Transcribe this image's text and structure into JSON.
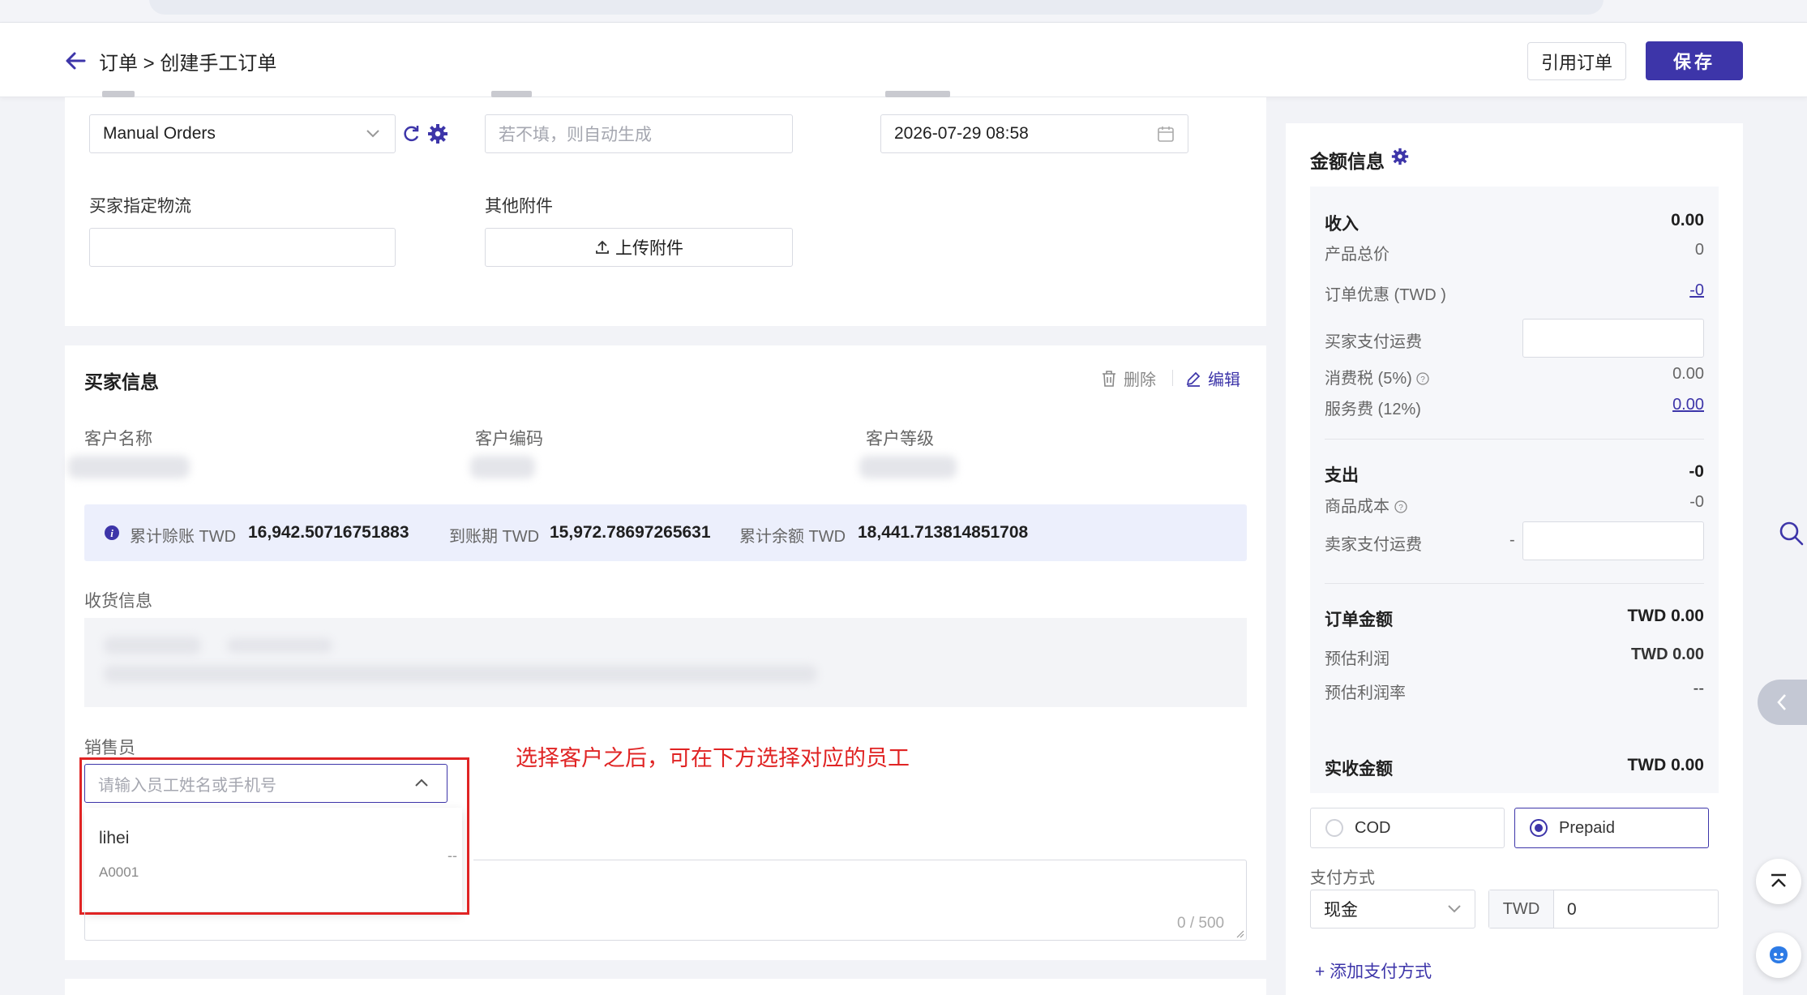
{
  "header": {
    "breadcrumb": "订单 > 创建手工订单",
    "reference_order_label": "引用订单",
    "save_label": "保存"
  },
  "order_info": {
    "store_select_value": "Manual Orders",
    "order_no_placeholder": "若不填，则自动生成",
    "order_time_value": "2026-07-29 08:58",
    "buyer_logistics_label": "买家指定物流",
    "attachments_label": "其他附件",
    "upload_label": "上传附件"
  },
  "buyer_info": {
    "title": "买家信息",
    "delete_label": "删除",
    "edit_label": "编辑",
    "customer_name_label": "客户名称",
    "customer_code_label": "客户编码",
    "customer_level_label": "客户等级",
    "stats": [
      {
        "label": "累计赊账 TWD",
        "value": "16,942.50716751883"
      },
      {
        "label": "到账期 TWD",
        "value": "15,972.78697265631"
      },
      {
        "label": "累计余额 TWD",
        "value": "18,441.713814851708"
      }
    ],
    "shipping_label": "收货信息",
    "sales_label": "销售员",
    "sales_placeholder": "请输入员工姓名或手机号",
    "dropdown_option_name": "lihei",
    "dropdown_option_code": "A0001",
    "dash": "--",
    "remark_counter": "0 / 500"
  },
  "annotation": {
    "text": "选择客户之后，可在下方选择对应的员工",
    "color": "#e02424"
  },
  "amount_panel": {
    "title": "金额信息",
    "income_label": "收入",
    "income_value": "0.00",
    "product_total_label": "产品总价",
    "product_total_value": "0",
    "order_discount_label": "订单优惠 (TWD )",
    "order_discount_value": "-0",
    "buyer_shipping_label": "买家支付运费",
    "consumption_tax_label": "消费税 (5%)",
    "consumption_tax_value": "0.00",
    "service_fee_label": "服务费 (12%)",
    "service_fee_value": "0.00",
    "expense_label": "支出",
    "expense_value": "-0",
    "product_cost_label": "商品成本",
    "product_cost_value": "-0",
    "seller_shipping_label": "卖家支付运费",
    "seller_shipping_prefix": "-",
    "order_amount_label": "订单金额",
    "order_amount_value": "TWD 0.00",
    "est_profit_label": "预估利润",
    "est_profit_value": "TWD 0.00",
    "est_margin_label": "预估利润率",
    "est_margin_value": "--",
    "received_label": "实收金额",
    "received_value": "TWD 0.00",
    "cod_label": "COD",
    "prepaid_label": "Prepaid",
    "payment_method_label": "支付方式",
    "payment_method_value": "现金",
    "currency_label": "TWD",
    "payment_amount_value": "0",
    "add_payment_label": "添加支付方式"
  },
  "colors": {
    "primary": "#3d35a9",
    "annotation_red": "#e02424",
    "info_bg": "#eceffc"
  }
}
